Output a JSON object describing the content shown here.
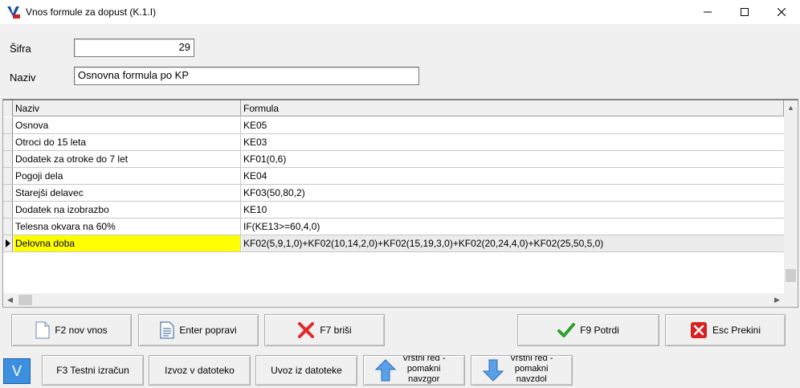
{
  "window": {
    "title": "Vnos formule za dopust  (K.1.I)"
  },
  "form": {
    "sifra_label": "Šifra",
    "sifra_value": "29",
    "naziv_label": "Naziv",
    "naziv_value": "Osnovna formula po KP"
  },
  "grid": {
    "columns": [
      "Naziv",
      "Formula"
    ],
    "rows": [
      {
        "naziv": "Osnova",
        "formula": "KE05"
      },
      {
        "naziv": "Otroci do 15 leta",
        "formula": "KE03"
      },
      {
        "naziv": "Dodatek za otroke do 7 let",
        "formula": "KF01(0,6)"
      },
      {
        "naziv": "Pogoji dela",
        "formula": "KE04"
      },
      {
        "naziv": "Starejši delavec",
        "formula": "KF03(50,80,2)"
      },
      {
        "naziv": "Dodatek na izobrazbo",
        "formula": "KE10"
      },
      {
        "naziv": "Telesna okvara na 60%",
        "formula": "IF(KE13>=60,4,0)"
      },
      {
        "naziv": "Delovna doba",
        "formula": "KF02(5,9,1,0)+KF02(10,14,2,0)+KF02(15,19,3,0)+KF02(20,24,4,0)+KF02(25,50,5,0)"
      }
    ],
    "selected_row": 7,
    "selected_color": "#ffff00"
  },
  "buttons": {
    "f2": "F2 nov vnos",
    "enter": "Enter popravi",
    "f7": "F7 briši",
    "f9": "F9 Potrdi",
    "esc": "Esc Prekini",
    "f3": "F3 Testni izračun",
    "export": "Izvoz v datoteko",
    "import": "Uvoz iz datoteke",
    "up_line1": "Vrstni red -",
    "up_line2": "pomakni",
    "up_line3": "navzgor",
    "down_line1": "Vrstni red -",
    "down_line2": "pomakni",
    "down_line3": "navzdol",
    "logo": "V"
  },
  "icons": {
    "new": "new-document-icon",
    "edit": "edit-document-icon",
    "delete": "red-x-icon",
    "confirm": "green-check-icon",
    "cancel": "red-cancel-icon",
    "up": "blue-up-arrow-icon",
    "down": "blue-down-arrow-icon"
  }
}
